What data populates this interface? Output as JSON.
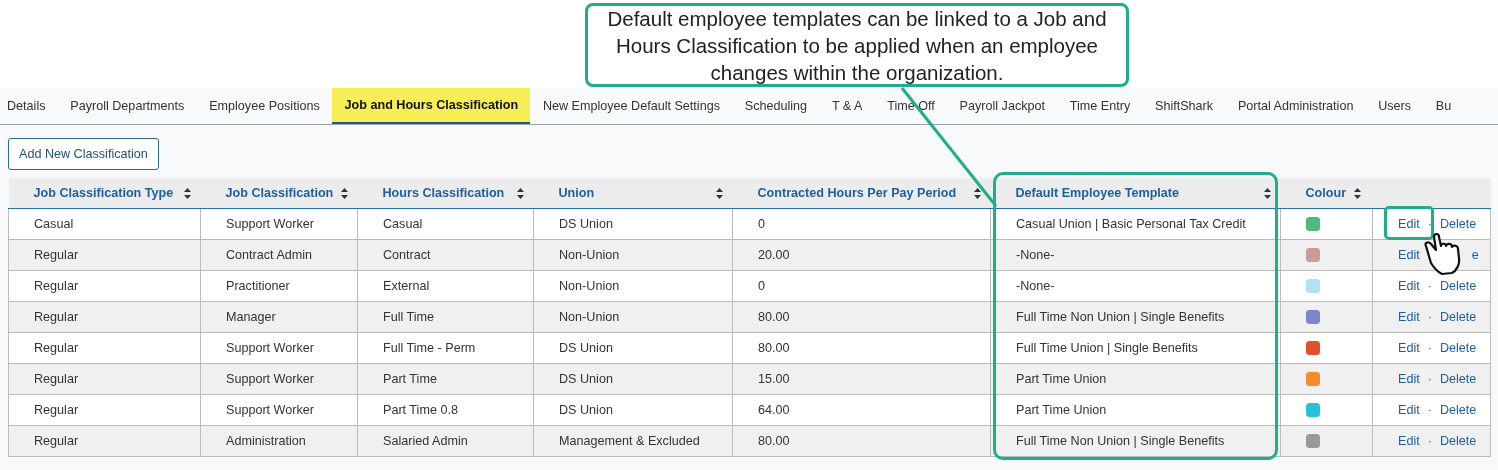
{
  "callout": {
    "text": "Default employee templates can be linked to a Job and Hours Classification to be applied when an employee changes within the organization."
  },
  "tabs": [
    {
      "label": "Details",
      "selected": false
    },
    {
      "label": "Payroll Departments",
      "selected": false
    },
    {
      "label": "Employee Positions",
      "selected": false
    },
    {
      "label": "Job and Hours Classification",
      "selected": true
    },
    {
      "label": "New Employee Default Settings",
      "selected": false
    },
    {
      "label": "Scheduling",
      "selected": false
    },
    {
      "label": "T & A",
      "selected": false
    },
    {
      "label": "Time Off",
      "selected": false
    },
    {
      "label": "Payroll Jackpot",
      "selected": false
    },
    {
      "label": "Time Entry",
      "selected": false
    },
    {
      "label": "ShiftShark",
      "selected": false
    },
    {
      "label": "Portal Administration",
      "selected": false
    },
    {
      "label": "Users",
      "selected": false
    },
    {
      "label": "Bu",
      "selected": false
    }
  ],
  "add_button": "Add New Classification",
  "table": {
    "columns": [
      "Job Classification Type",
      "Job Classification",
      "Hours Classification",
      "Union",
      "Contracted Hours Per Pay Period",
      "Default Employee Template",
      "Colour"
    ],
    "rows": [
      {
        "cells": [
          "Casual",
          "Support Worker",
          "Casual",
          "DS Union",
          "0",
          "Casual Union | Basic Personal Tax Credit"
        ],
        "color": "#4dbb7d",
        "edit": "Edit",
        "separator": "·",
        "delete": "Delete"
      },
      {
        "cells": [
          "Regular",
          "Contract Admin",
          "Contract",
          "Non-Union",
          "20.00",
          "-None-"
        ],
        "color": "#cc9a9a",
        "edit": "Edit",
        "delete": "e"
      },
      {
        "cells": [
          "Regular",
          "Practitioner",
          "External",
          "Non-Union",
          "0",
          "-None-"
        ],
        "color": "#b4e0f7",
        "edit": "Edit",
        "separator": "·",
        "delete": "Delete"
      },
      {
        "cells": [
          "Regular",
          "Manager",
          "Full Time",
          "Non-Union",
          "80.00",
          "Full Time Non Union | Single Benefits"
        ],
        "color": "#7f86cb",
        "edit": "Edit",
        "separator": "·",
        "delete": "Delete"
      },
      {
        "cells": [
          "Regular",
          "Support Worker",
          "Full Time - Perm",
          "DS Union",
          "80.00",
          "Full Time Union | Single Benefits"
        ],
        "color": "#e0502a",
        "edit": "Edit",
        "separator": "·",
        "delete": "Delete"
      },
      {
        "cells": [
          "Regular",
          "Support Worker",
          "Part Time",
          "DS Union",
          "15.00",
          "Part Time Union"
        ],
        "color": "#f58b26",
        "edit": "Edit",
        "separator": "·",
        "delete": "Delete"
      },
      {
        "cells": [
          "Regular",
          "Support Worker",
          "Part Time 0.8",
          "DS Union",
          "64.00",
          "Part Time Union"
        ],
        "color": "#27c0d6",
        "edit": "Edit",
        "separator": "·",
        "delete": "Delete"
      },
      {
        "cells": [
          "Regular",
          "Administration",
          "Salaried Admin",
          "Management & Excluded",
          "80.00",
          "Full Time Non Union | Single Benefits"
        ],
        "color": "#9a9a9a",
        "edit": "Edit",
        "separator": "·",
        "delete": "Delete"
      }
    ]
  }
}
